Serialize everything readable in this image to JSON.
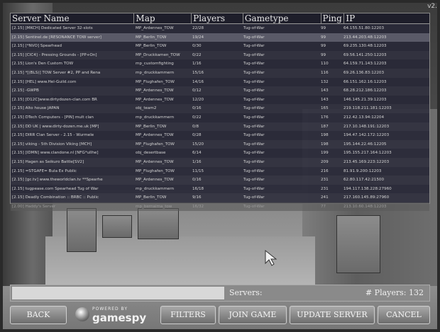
{
  "version": "v2.",
  "columns": [
    "Server Name",
    "Map",
    "Players",
    "Gametype",
    "Ping",
    "IP"
  ],
  "rows": [
    [
      "[2.15] [MKCH] Dedicated Server 32-slots",
      "MP_Ardennes_TOW",
      "22/28",
      "Tug-of-War",
      "99",
      "64.155.51.80:12203"
    ],
    [
      "[2.15] Sentinel.de [RESONANCE TOW server]",
      "MP_Berlin_TOW",
      "19/24",
      "Tug-of-War",
      "99",
      "213.44.203.48:12203"
    ],
    [
      "[2.15] [*NVO] Spearhead",
      "MP_Berlin_TOW",
      "0/30",
      "Tug-of-War",
      "99",
      "69.235.130.48:12203"
    ],
    [
      "[2.15] [CIC4] - Pressing Grounds - [PP+On]",
      "MP_Druckkamen_TOW",
      "0/22",
      "Tug-of-War",
      "99",
      "69.56.141.250:12203"
    ],
    [
      "[2.15] Lion's Den Custom TOW",
      "mp_customfighting",
      "1/16",
      "Tug-of-War",
      "110",
      "64.159.71.143:12203"
    ],
    [
      "[2.15] *[(BLS)] TOW Server #2, PP and Rena",
      "mp_druckkammern",
      "15/16",
      "Tug-of-War",
      "116",
      "69.26.136.83:12203"
    ],
    [
      "[2.15] [HEL] www.Hel-Guild.com",
      "MP_Flughafen_TOW",
      "14/16",
      "Tug-of-War",
      "132",
      "66.151.162.16:12203"
    ],
    [
      "[2.15] -GWPB",
      "MP_Ardennes_TOW",
      "0/12",
      "Tug-of-War",
      "143",
      "68.28.212.186:12203"
    ],
    [
      "[2.15] [D12C]www.dirtydozen-clan.com BR",
      "MP_Ardennes_TOW",
      "12/20",
      "Tug-of-War",
      "143",
      "146.145.21.39:12203"
    ],
    [
      "[2.15] Alto house JAPAN",
      "obj_team2",
      "0/16",
      "Tug-of-War",
      "165",
      "219.118.211.181:12203"
    ],
    [
      "[2.15] DTech Computers - [PIN] mult clan",
      "mp_druckkammern",
      "0/22",
      "Tug-of-War",
      "176",
      "212.42.13.94:12204"
    ],
    [
      "[2.15] DD UK | www.dirty-dozen.me.uk [MP]",
      "MP_Berlin_TOW",
      "0/8",
      "Tug-of-War",
      "187",
      "217.10.148.191:12203"
    ],
    [
      "[2.15] DIRR Clan Server - 2.15 - Wurmele",
      "MP_Ardennes_TOW",
      "0/28",
      "Tug-of-War",
      "198",
      "194.47.142.172:12203"
    ],
    [
      "[2.15] viking - 5th Division Viking [MCH]",
      "MP_Flughafen_TOW",
      "15/20",
      "Tug-of-War",
      "198",
      "195.144.22.46:12205"
    ],
    [
      "[2.15] [IDMN] www.clandone.nl [NFG*uIlhe]",
      "obj_desertbase",
      "6/14",
      "Tug-of-War",
      "199",
      "195.155.217.164:12203"
    ],
    [
      "[2.15] Hagen as Seikuro Battle[SV2]",
      "MP_Ardennes_TOW",
      "1/16",
      "Tug-of-War",
      "209",
      "213.45.169.223:12203"
    ],
    [
      "[2.15] =STGAFE= Bula Ex Public",
      "MP_Flughafen_TOW",
      "11/15",
      "Tug-of-War",
      "216",
      "81.91.9.200:12203"
    ],
    [
      "[2.15] [gc.tv] www.theworldclan.tv **Spearhe",
      "MP_Ardennes_TOW",
      "0/16",
      "Tug-of-War",
      "231",
      "62.80.117.42:21500"
    ],
    [
      "[2.15] tugpease.com Spearhead Tug of War",
      "mp_druckkammern",
      "16/18",
      "Tug-of-War",
      "231",
      "194.117.138.228:27960"
    ],
    [
      "[2.15] Deadly Combination :: BRBC :: Public",
      "MP_Berlin_TOW",
      "9/16",
      "Tug-of-War",
      "241",
      "217.160.145.89:27960"
    ],
    [
      "[2.00] Haddy's Server",
      "mp_bernaima_tow",
      "16/32",
      "Tug-of-War",
      "77",
      "213.10.60.148:12203"
    ]
  ],
  "status": {
    "label": "Servers:",
    "players": "# Players: 132",
    "progress": 0.51
  },
  "buttons": {
    "back": "BACK",
    "filters": "FILTERS",
    "join": "JOIN GAME",
    "update": "UPDATE SERVER",
    "cancel": "CANCEL"
  },
  "logo": {
    "small": "POWERED BY",
    "big": "gamespy"
  }
}
